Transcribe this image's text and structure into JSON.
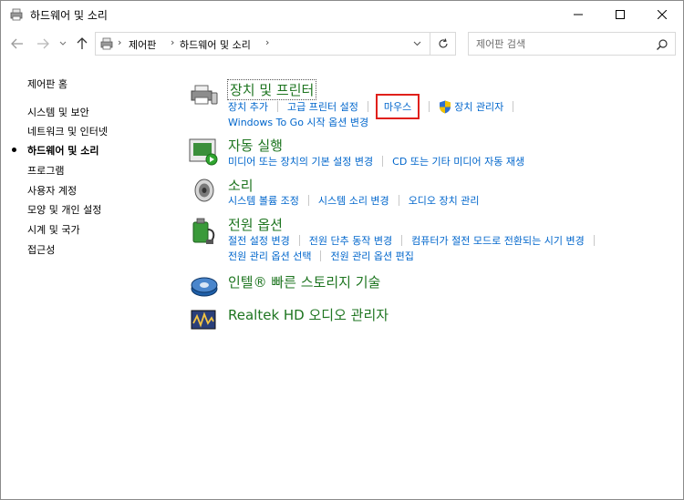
{
  "window": {
    "title": "하드웨어 및 소리"
  },
  "address": {
    "breadcrumbs": [
      "제어판",
      "하드웨어 및 소리"
    ],
    "search_placeholder": "제어판 검색"
  },
  "sidebar": {
    "home": "제어판 홈",
    "items": [
      {
        "label": "시스템 및 보안",
        "current": false
      },
      {
        "label": "네트워크 및 인터넷",
        "current": false
      },
      {
        "label": "하드웨어 및 소리",
        "current": true
      },
      {
        "label": "프로그램",
        "current": false
      },
      {
        "label": "사용자 계정",
        "current": false
      },
      {
        "label": "모양 및 개인 설정",
        "current": false
      },
      {
        "label": "시계 및 국가",
        "current": false
      },
      {
        "label": "접근성",
        "current": false
      }
    ]
  },
  "categories": {
    "devices": {
      "title": "장치 및 프린터",
      "links": [
        "장치 추가",
        "고급 프린터 설정",
        "마우스",
        "장치 관리자"
      ],
      "links2": [
        "Windows To Go 시작 옵션 변경"
      ]
    },
    "autoplay": {
      "title": "자동 실행",
      "links": [
        "미디어 또는 장치의 기본 설정 변경",
        "CD 또는 기타 미디어 자동 재생"
      ]
    },
    "sound": {
      "title": "소리",
      "links": [
        "시스템 볼륨 조정",
        "시스템 소리 변경",
        "오디오 장치 관리"
      ]
    },
    "power": {
      "title": "전원 옵션",
      "links": [
        "절전 설정 변경",
        "전원 단추 동작 변경",
        "컴퓨터가 절전 모드로 전환되는 시기 변경"
      ],
      "links2": [
        "전원 관리 옵션 선택",
        "전원 관리 옵션 편집"
      ]
    },
    "intel": {
      "title": "인텔® 빠른 스토리지 기술"
    },
    "realtek": {
      "title": "Realtek HD 오디오 관리자"
    }
  },
  "colors": {
    "category_title": "#1e7520",
    "link": "#0066cc",
    "highlight_box": "#e0201b"
  }
}
